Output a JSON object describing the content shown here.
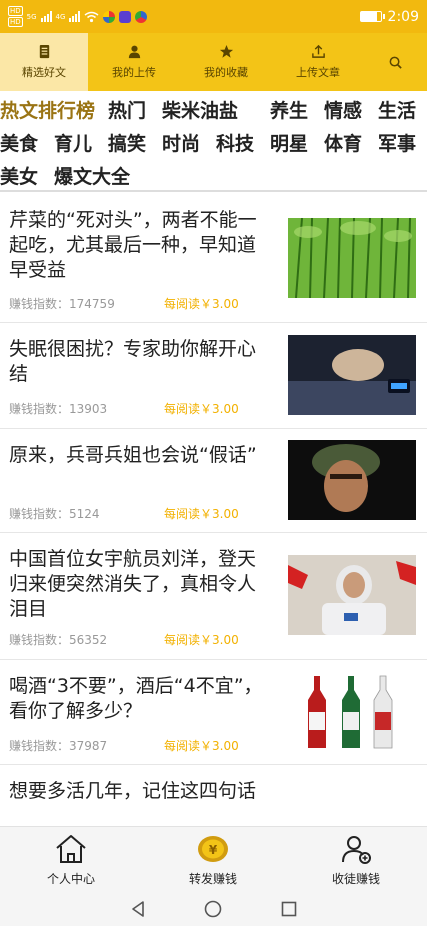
{
  "status_bar": {
    "time": "2:09",
    "chip_top": "HD",
    "chip_bottom": "HD",
    "net1": "5G",
    "net2": "4G",
    "colors": {
      "background": "#f2b90f"
    }
  },
  "top_tabs": [
    {
      "label": "精选好文",
      "icon": "document-icon",
      "active": true
    },
    {
      "label": "我的上传",
      "icon": "person-icon",
      "active": false
    },
    {
      "label": "我的收藏",
      "icon": "star-icon",
      "active": false
    },
    {
      "label": "上传文章",
      "icon": "upload-icon",
      "active": false
    },
    {
      "label": "",
      "icon": "search-icon",
      "active": false
    }
  ],
  "categories": {
    "hot_label": "热文排行榜",
    "items": [
      "热门",
      "柴米油盐",
      "养生",
      "情感",
      "生活",
      "美食",
      "育儿",
      "搞笑",
      "时尚",
      "科技",
      "明星",
      "体育",
      "军事",
      "美女",
      "爆文大全"
    ]
  },
  "feed": {
    "metric_label": "赚钱指数：",
    "reward_label": "每阅读￥3.00",
    "articles": [
      {
        "title": "芹菜的“死对头”，两者不能一起吃，尤其最后一种，早知道早受益",
        "index": "174759",
        "reward": "每阅读￥3.00",
        "thumb": "celery"
      },
      {
        "title": "失眠很困扰？专家助你解开心结",
        "index": "13903",
        "reward": "每阅读￥3.00",
        "thumb": "sleep"
      },
      {
        "title": "原来，兵哥兵姐也会说“假话”",
        "index": "5124",
        "reward": "每阅读￥3.00",
        "thumb": "soldier"
      },
      {
        "title": "中国首位女宇航员刘洋，登天归来便突然消失了，真相令人泪目",
        "index": "56352",
        "reward": "每阅读￥3.00",
        "thumb": "astronaut"
      },
      {
        "title": "喝酒“3不要”，酒后“4不宜”，看你了解多少？",
        "index": "37987",
        "reward": "每阅读￥3.00",
        "thumb": "bottles"
      },
      {
        "title": "想要多活几年，记住这四句话",
        "index": "",
        "reward": "",
        "thumb": ""
      }
    ]
  },
  "bottom_nav": [
    {
      "label": "个人中心",
      "icon": "home-icon"
    },
    {
      "label": "转发赚钱",
      "icon": "coin-icon"
    },
    {
      "label": "收徒赚钱",
      "icon": "user-add-icon"
    }
  ],
  "colors": {
    "accent": "#f3c417",
    "reward": "#f2b100",
    "hot": "#9a7414"
  }
}
